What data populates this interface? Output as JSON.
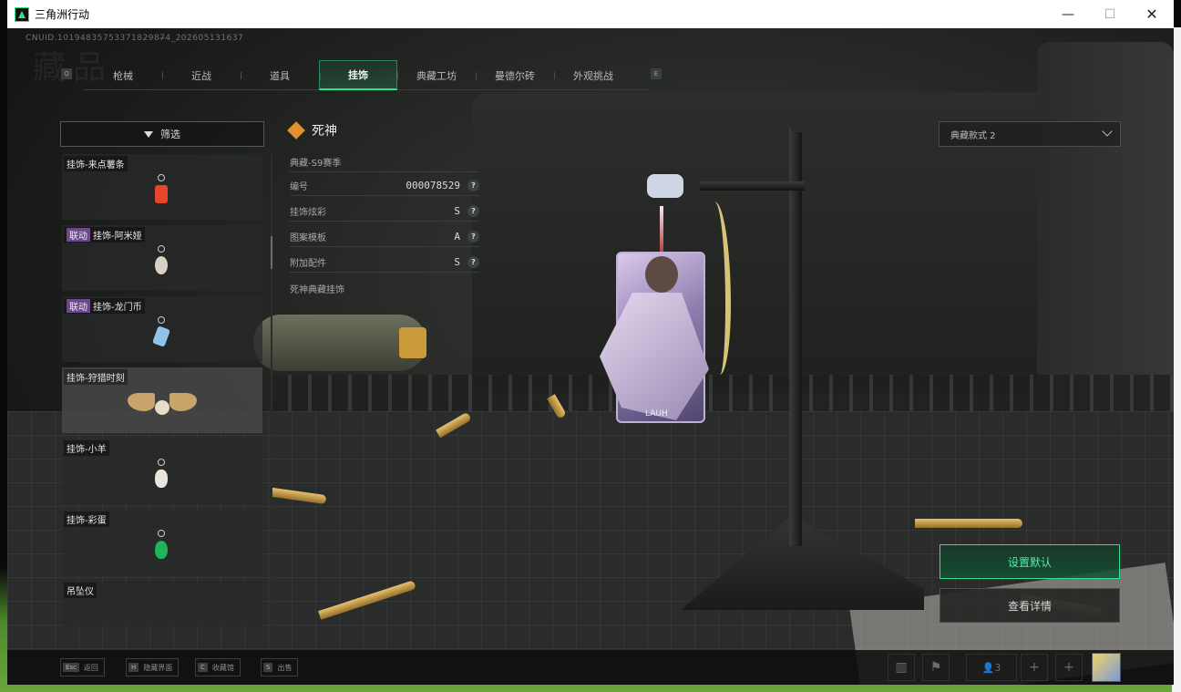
{
  "window": {
    "title": "三角洲行动",
    "controls": {
      "minimize": "—",
      "maximize": "☐",
      "close": "✕"
    }
  },
  "header": {
    "uid": "CNUID.1019483575337182987̶4_202605131637",
    "watermark": "藏品",
    "key_prev": "Q",
    "key_next": "E",
    "tabs": [
      {
        "label": "枪械",
        "active": false
      },
      {
        "label": "近战",
        "active": false
      },
      {
        "label": "道具",
        "active": false
      },
      {
        "label": "挂饰",
        "active": true
      },
      {
        "label": "典藏工坊",
        "active": false
      },
      {
        "label": "曼德尔砖",
        "active": false
      },
      {
        "label": "外观挑战",
        "active": false
      }
    ]
  },
  "filter": {
    "label": "筛选",
    "icon": "filter-icon"
  },
  "list": {
    "items": [
      {
        "tag": "",
        "name": "挂饰-来点薯条",
        "charm_color": "#e8462c"
      },
      {
        "tag": "联动",
        "name": "挂饰-阿米娅",
        "charm_color": "#d9d2c4"
      },
      {
        "tag": "联动",
        "name": "挂饰-龙门币",
        "charm_color": "#8fc4e8"
      },
      {
        "tag": "",
        "name": "挂饰-狩猎时刻",
        "charm_color": "#c8a46a",
        "selected": true
      },
      {
        "tag": "",
        "name": "挂饰-小羊",
        "charm_color": "#e9e4dc"
      },
      {
        "tag": "",
        "name": "挂饰-彩蛋",
        "charm_color": "#1fb35a"
      },
      {
        "tag": "",
        "name": "吊坠仪",
        "charm_color": "#777777"
      }
    ]
  },
  "detail": {
    "title": "死神",
    "season": "典藏-S9赛季",
    "rows": [
      {
        "label": "编号",
        "value": "000078529"
      },
      {
        "label": "挂饰炫彩",
        "value": "S"
      },
      {
        "label": "图案模板",
        "value": "A"
      },
      {
        "label": "附加配件",
        "value": "S"
      }
    ],
    "footer": "死神典藏挂饰",
    "help_glyph": "?"
  },
  "charm_card_label": "LAUH",
  "style_select": {
    "value": "典藏款式 2"
  },
  "actions": {
    "set_default": "设置默认",
    "view_detail": "查看详情"
  },
  "bottom": {
    "hints": [
      {
        "key": "Esc",
        "label": "返回"
      },
      {
        "key": "H",
        "label": "隐藏界面"
      },
      {
        "key": "C",
        "label": "收藏馆"
      },
      {
        "key": "S",
        "label": "出售"
      }
    ],
    "squad_count": "3",
    "plus": "+"
  },
  "colors": {
    "accent": "#2ee38a",
    "link_tag": "#6b4a8c",
    "diamond": "#e0902c"
  }
}
